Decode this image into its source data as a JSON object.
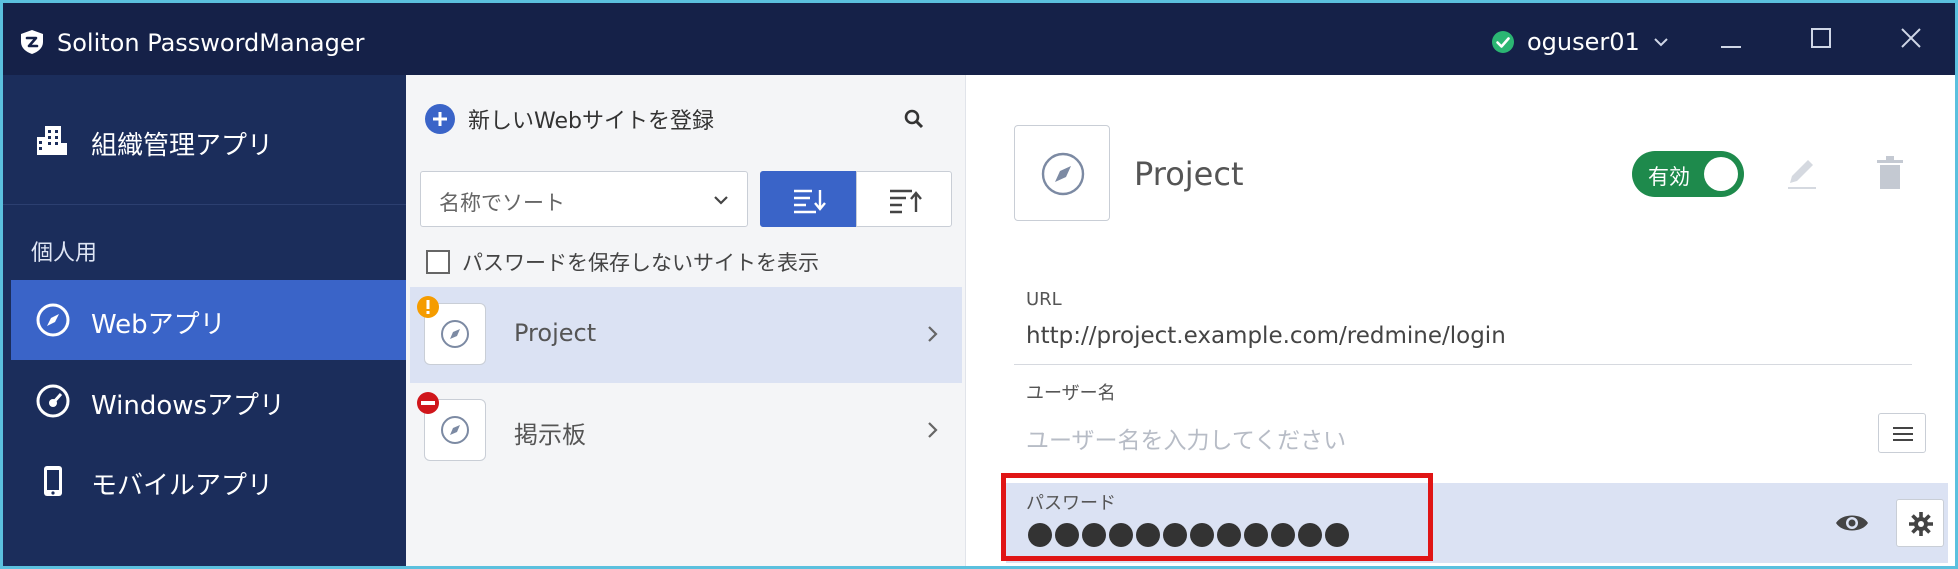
{
  "titlebar": {
    "app_title": "Soliton PasswordManager",
    "user_name": "oguser01",
    "status_color": "#2bb673"
  },
  "sidebar": {
    "org_label": "組織管理アプリ",
    "section_label": "個人用",
    "items": [
      {
        "label": "Webアプリ",
        "icon": "compass-icon",
        "active": true
      },
      {
        "label": "Windowsアプリ",
        "icon": "gauge-icon",
        "active": false
      },
      {
        "label": "モバイルアプリ",
        "icon": "mobile-icon",
        "active": false
      }
    ]
  },
  "list": {
    "add_label": "新しいWebサイトを登録",
    "sort_value": "名称でソート",
    "show_no_password_label": "パスワードを保存しないサイトを表示",
    "items": [
      {
        "name": "Project",
        "badge": "warning",
        "selected": true
      },
      {
        "name": "掲示板",
        "badge": "blocked",
        "selected": false
      }
    ]
  },
  "detail": {
    "title": "Project",
    "toggle_label": "有効",
    "url_label": "URL",
    "url_value": "http://project.example.com/redmine/login",
    "username_label": "ユーザー名",
    "username_placeholder": "ユーザー名を入力してください",
    "password_label": "パスワード",
    "password_masked": "●●●●●●●●●●●●"
  },
  "colors": {
    "titlebar_bg": "#152148",
    "sidebar_bg": "#1b2d5b",
    "accent": "#3a64c8",
    "toggle_on": "#1e8a4c",
    "highlight": "#e01515"
  }
}
